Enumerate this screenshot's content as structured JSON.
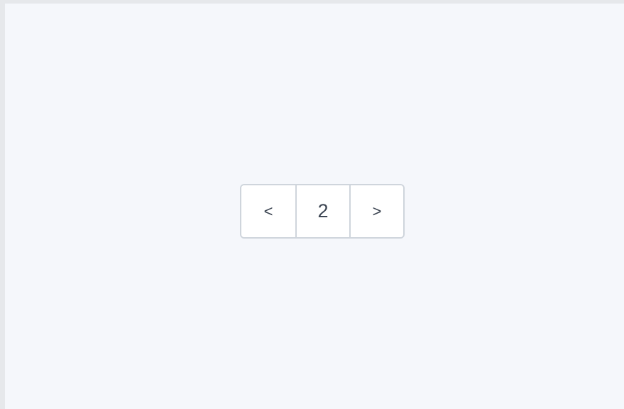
{
  "pagination": {
    "prev_label": "<",
    "current_page": "2",
    "next_label": ">"
  },
  "colors": {
    "background": "#f5f7fb",
    "frame_border": "#e6e8eb",
    "button_border": "#cfd5dc",
    "button_bg": "#ffffff",
    "text": "#3a4350"
  }
}
